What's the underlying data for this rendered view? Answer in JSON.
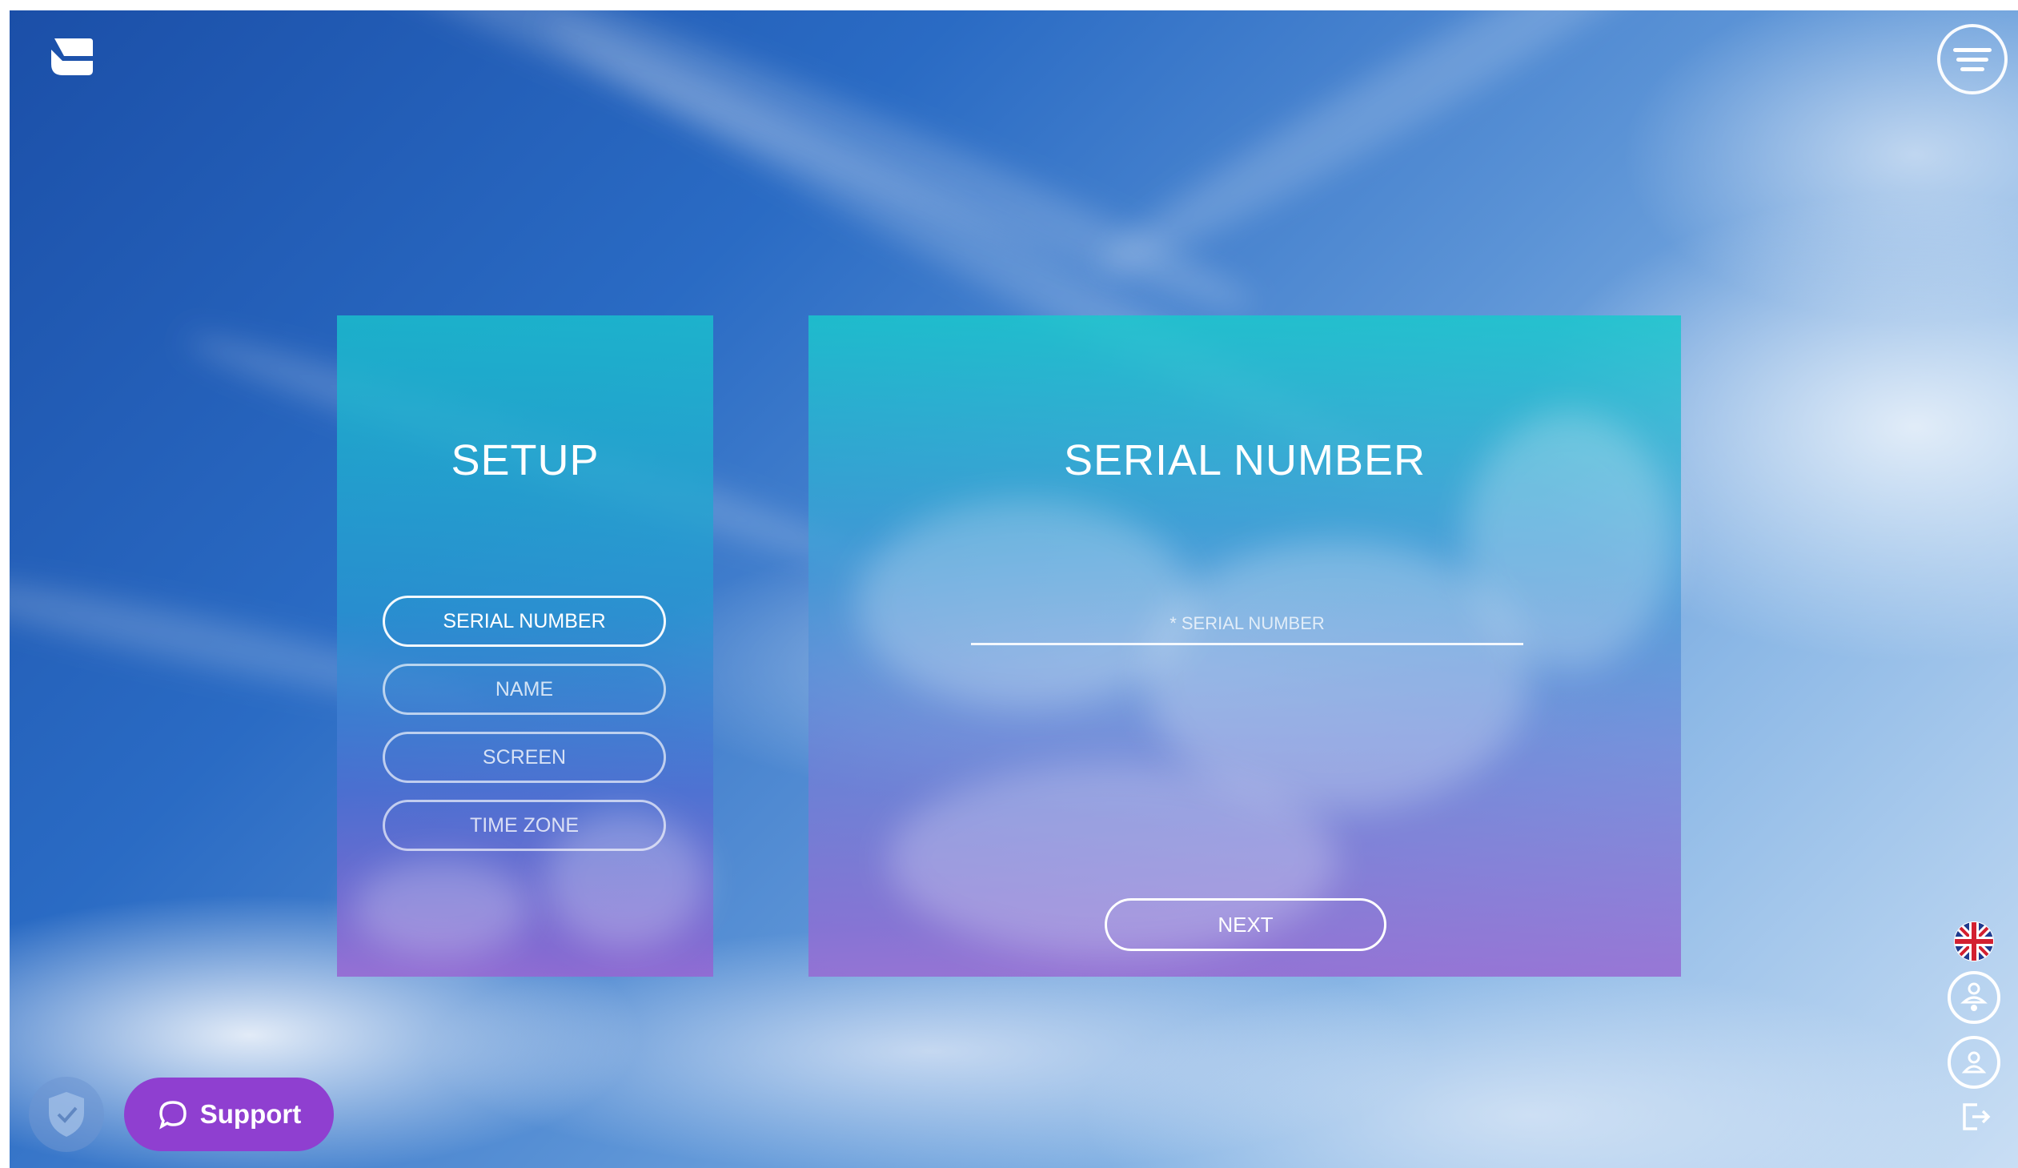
{
  "setup_panel": {
    "title": "SETUP",
    "nav_items": [
      {
        "label": "SERIAL NUMBER",
        "active": true
      },
      {
        "label": "NAME",
        "active": false
      },
      {
        "label": "SCREEN",
        "active": false
      },
      {
        "label": "TIME ZONE",
        "active": false
      }
    ]
  },
  "serial_panel": {
    "title": "SERIAL NUMBER",
    "input_value": "",
    "input_placeholder": "* SERIAL NUMBER",
    "next_label": "NEXT"
  },
  "support": {
    "label": "Support"
  },
  "icons": {
    "logo": "app-logo-icon",
    "menu": "menu-icon",
    "language": "uk-flag-icon",
    "user_settings": "user-settings-icon",
    "user": "user-icon",
    "logout": "logout-icon",
    "shield": "shield-check-icon"
  },
  "colors": {
    "support_button": "#8f3fd0",
    "panel_top": "#1abecd",
    "panel_bottom": "#966ad2"
  }
}
